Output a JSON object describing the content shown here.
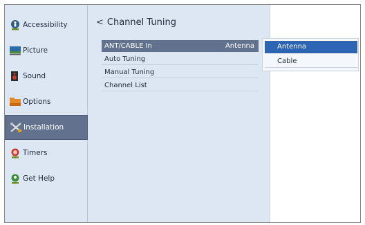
{
  "sidebar": {
    "items": [
      {
        "label": "Accessibility",
        "icon": "accessibility-icon",
        "selected": false
      },
      {
        "label": "Picture",
        "icon": "picture-icon",
        "selected": false
      },
      {
        "label": "Sound",
        "icon": "sound-icon",
        "selected": false
      },
      {
        "label": "Options",
        "icon": "options-icon",
        "selected": false
      },
      {
        "label": "Installation",
        "icon": "installation-icon",
        "selected": true
      },
      {
        "label": "Timers",
        "icon": "timers-icon",
        "selected": false
      },
      {
        "label": "Get Help",
        "icon": "get-help-icon",
        "selected": false
      }
    ]
  },
  "main": {
    "title": "Channel Tuning",
    "back_icon": "chevron-left-icon",
    "rows": [
      {
        "label": "ANT/CABLE In",
        "value": "Antenna",
        "selected": true
      },
      {
        "label": "Auto Tuning",
        "value": "",
        "selected": false
      },
      {
        "label": "Manual Tuning",
        "value": "",
        "selected": false
      },
      {
        "label": "Channel List",
        "value": "",
        "selected": false
      }
    ]
  },
  "dropdown": {
    "options": [
      {
        "label": "Antenna",
        "selected": true
      },
      {
        "label": "Cable",
        "selected": false
      }
    ]
  },
  "colors": {
    "panel_bg": "#dde7f3",
    "selection_gray_blue": "#62718d",
    "dropdown_highlight": "#2d64b3"
  }
}
